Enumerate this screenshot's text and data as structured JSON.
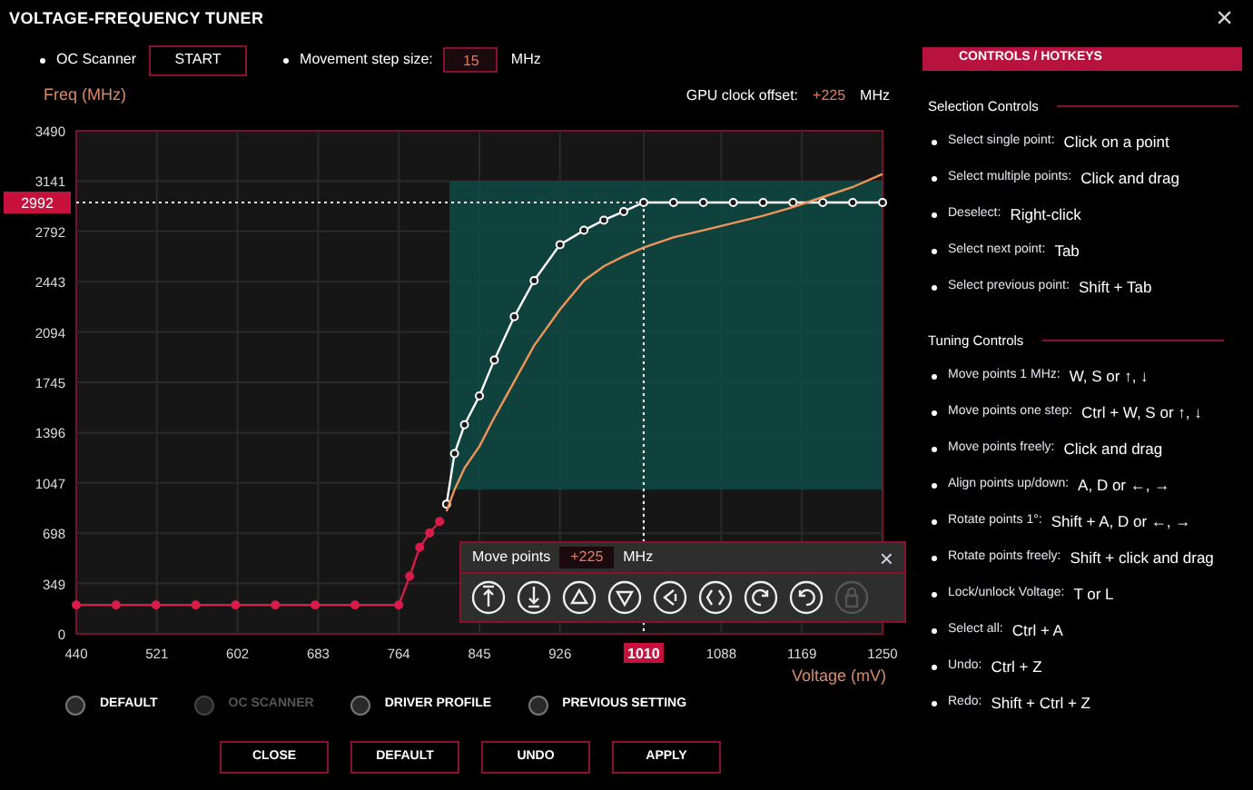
{
  "window": {
    "title": "VOLTAGE-FREQUENCY TUNER",
    "close": "×"
  },
  "toolbar": {
    "oc_scanner_label": "OC Scanner",
    "start_button": "START",
    "step_label": "Movement step size:",
    "step_value": "15",
    "step_unit": "MHz"
  },
  "chart_header": {
    "offset_label": "GPU clock offset:",
    "offset_value": "+225",
    "offset_unit": "MHz"
  },
  "chart": {
    "chart_data": {
      "type": "line",
      "xlabel": "Voltage (mV)",
      "ylabel": "Freq (MHz)",
      "x": [
        440,
        480,
        520,
        560,
        600,
        640,
        680,
        720,
        764,
        775,
        785,
        795,
        805,
        812,
        820,
        830,
        845,
        860,
        880,
        900,
        926,
        950,
        970,
        990,
        1010,
        1040,
        1070,
        1100,
        1130,
        1160,
        1190,
        1220,
        1250
      ],
      "series": [
        {
          "color": "#d81b48",
          "marker": "o",
          "values": [
            200,
            200,
            200,
            200,
            200,
            200,
            200,
            200,
            200,
            400,
            600,
            700,
            780,
            null,
            null,
            null,
            null,
            null,
            null,
            null,
            null,
            null,
            null,
            null,
            null,
            null,
            null,
            null,
            null,
            null,
            null,
            null,
            null
          ]
        },
        {
          "color": "#ffffff",
          "marker": "o",
          "values": [
            null,
            null,
            null,
            null,
            null,
            null,
            null,
            null,
            null,
            null,
            null,
            null,
            null,
            900,
            1250,
            1450,
            1650,
            1900,
            2200,
            2450,
            2700,
            2800,
            2870,
            2930,
            2992,
            2992,
            2992,
            2992,
            2992,
            2992,
            2992,
            2992,
            2992
          ]
        },
        {
          "color": "#f0955a",
          "values": [
            null,
            null,
            null,
            null,
            null,
            null,
            null,
            null,
            null,
            null,
            null,
            null,
            null,
            850,
            1000,
            1150,
            1300,
            1500,
            1750,
            2000,
            2250,
            2450,
            2550,
            2620,
            2680,
            2750,
            2800,
            2850,
            2900,
            2960,
            3030,
            3100,
            3190
          ]
        }
      ],
      "xlim": [
        440,
        1250
      ],
      "ylim": [
        0,
        3490
      ],
      "grid": true,
      "xticks": [
        440,
        521,
        602,
        683,
        764,
        845,
        926,
        1010,
        1088,
        1169,
        1250
      ],
      "yticks": [
        0,
        349,
        698,
        1047,
        1396,
        1745,
        2094,
        2443,
        2792,
        3141,
        3490
      ],
      "ref_lines": [
        {
          "axis": "y",
          "value": 2992,
          "label": "2992"
        },
        {
          "axis": "x",
          "value": 1010,
          "label": "1010"
        }
      ]
    }
  },
  "move_points": {
    "label": "Move points",
    "value": "+225",
    "unit": "MHz",
    "close": "×",
    "buttons": [
      {
        "kind": "top",
        "disabled": false
      },
      {
        "kind": "bottom",
        "disabled": false
      },
      {
        "kind": "up",
        "disabled": false
      },
      {
        "kind": "down",
        "disabled": false
      },
      {
        "kind": "left",
        "disabled": false
      },
      {
        "kind": "split",
        "disabled": false
      },
      {
        "kind": "rotate_cw",
        "disabled": false
      },
      {
        "kind": "rotate_ccw",
        "disabled": false
      },
      {
        "kind": "lock",
        "disabled": true
      }
    ]
  },
  "presets": [
    {
      "label": "DEFAULT",
      "selected": false,
      "disabled": false
    },
    {
      "label": "OC SCANNER",
      "selected": false,
      "disabled": true
    },
    {
      "label": "DRIVER PROFILE",
      "selected": false,
      "disabled": false
    },
    {
      "label": "PREVIOUS SETTING",
      "selected": false,
      "disabled": false
    }
  ],
  "buttons": [
    "CLOSE",
    "DEFAULT",
    "UNDO",
    "APPLY"
  ],
  "hotkeys": {
    "title": "CONTROLS / HOTKEYS",
    "sections": [
      {
        "title": "Selection Controls",
        "items": [
          {
            "label": "Select single point:",
            "key": "Click on a point"
          },
          {
            "label": "Select multiple points:",
            "key": "Click and drag"
          },
          {
            "label": "Deselect:",
            "key": "Right-click"
          },
          {
            "label": "Select next point:",
            "key": "Tab"
          },
          {
            "label": "Select previous point:",
            "key": "Shift + Tab"
          }
        ]
      },
      {
        "title": "Tuning Controls",
        "items": [
          {
            "label": "Move points 1 MHz:",
            "key": "W, S or ↑, ↓"
          },
          {
            "label": "Move points one step:",
            "key": "Ctrl + W, S or ↑, ↓"
          },
          {
            "label": "Move points freely:",
            "key": "Click and drag"
          },
          {
            "label": "Align points up/down:",
            "key": "A, D or ←, →"
          },
          {
            "label": "Rotate points 1°:",
            "key": "Shift + A, D or ←, →"
          },
          {
            "label": "Rotate points freely:",
            "key": "Shift + click and drag"
          },
          {
            "label": "Lock/unlock Voltage:",
            "key": "T or L"
          },
          {
            "label": "Select all:",
            "key": "Ctrl + A"
          },
          {
            "label": "Undo:",
            "key": "Ctrl + Z"
          },
          {
            "label": "Redo:",
            "key": "Shift + Ctrl + Z"
          }
        ]
      }
    ]
  }
}
